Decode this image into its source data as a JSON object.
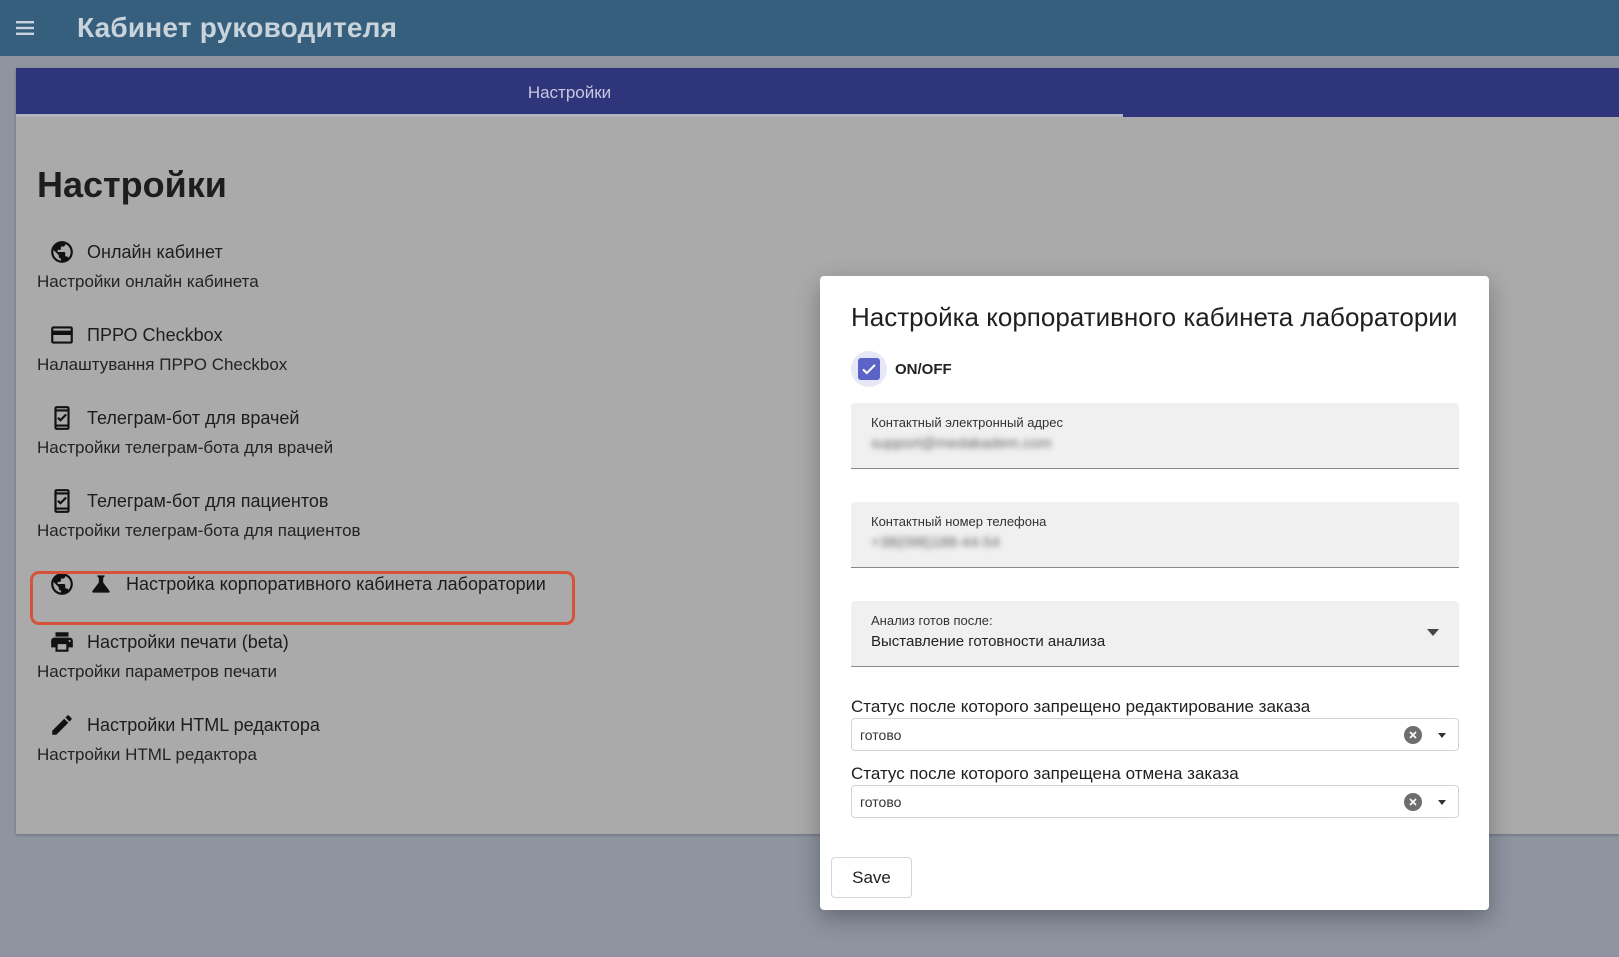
{
  "header": {
    "title": "Кабинет руководителя"
  },
  "tabs": [
    {
      "label": "Настройки",
      "active": true
    }
  ],
  "page": {
    "title": "Настройки"
  },
  "settings": [
    {
      "label": "Онлайн кабинет",
      "sub": "Настройки онлайн кабинета",
      "icon": "globe-icon"
    },
    {
      "label": "ПРРО Checkbox",
      "sub": "Налаштування ПРРО Checkbox",
      "icon": "card-icon"
    },
    {
      "label": "Телеграм-бот для врачей",
      "sub": "Настройки телеграм-бота для врачей",
      "icon": "phone-check-icon"
    },
    {
      "label": "Телеграм-бот для пациентов",
      "sub": "Настройки телеграм-бота для пациентов",
      "icon": "phone-check-icon"
    },
    {
      "label": "Настройка корпоративного кабинета лаборатории",
      "sub": "",
      "icon": "flask-icon",
      "highlighted": true
    },
    {
      "label": "Настройки печати (beta)",
      "sub": "Настройки параметров печати",
      "icon": "printer-icon"
    },
    {
      "label": "Настройки HTML редактора",
      "sub": "Настройки HTML редактора",
      "icon": "pencil-icon"
    }
  ],
  "dialog": {
    "title": "Настройка корпоративного кабинета лаборатории",
    "toggle": {
      "label": "ON/OFF",
      "checked": true
    },
    "email": {
      "label": "Контактный электронный адрес",
      "value": "support@medakadem.com"
    },
    "phone": {
      "label": "Контактный номер телефона",
      "value": "+38(098)188-44-54"
    },
    "ready": {
      "label": "Анализ готов после:",
      "value": "Выставление готовности анализа"
    },
    "edit_status": {
      "label": "Статус после которого запрещено редактирование заказа",
      "value": "готово"
    },
    "cancel_status": {
      "label": "Статус после которого запрещена отмена заказа",
      "value": "готово"
    },
    "save_label": "Save"
  },
  "colors": {
    "topbar": "#355f7c",
    "tabbar": "#2f357a",
    "accent": "#5b63c7",
    "highlight": "#d6533a"
  }
}
